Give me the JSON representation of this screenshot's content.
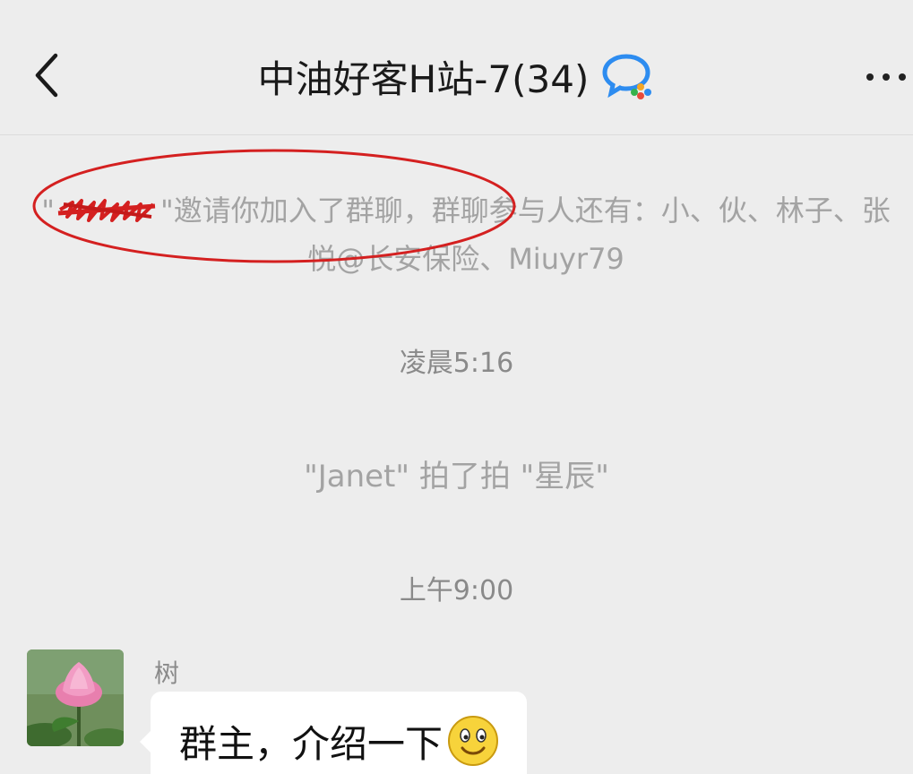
{
  "header": {
    "title": "中油好客H站-7(34)",
    "group_icon": "chat-bubble-group-icon",
    "back_icon": "chevron-left-icon",
    "more_icon": "more-dots-icon"
  },
  "system": {
    "invite_open_quote": "\"",
    "invite_text": "\"邀请你加入了群聊，群聊参与人还有：小、伙、林子、张悦@长安保险、Miuyr79",
    "timestamp_1": "凌晨5:16",
    "pat_text": "\"Janet\" 拍了拍 \"星辰\"",
    "timestamp_2": "上午9:00"
  },
  "message": {
    "sender": "树",
    "text": "群主，介绍一下",
    "emoji": "smile-emoji-icon",
    "avatar": "lotus-avatar"
  },
  "colors": {
    "background": "#ededed",
    "system_text": "#a3a3a3",
    "bubble": "#ffffff",
    "annotation_red": "#d42020",
    "brand_blue": "#2d8cf0"
  }
}
